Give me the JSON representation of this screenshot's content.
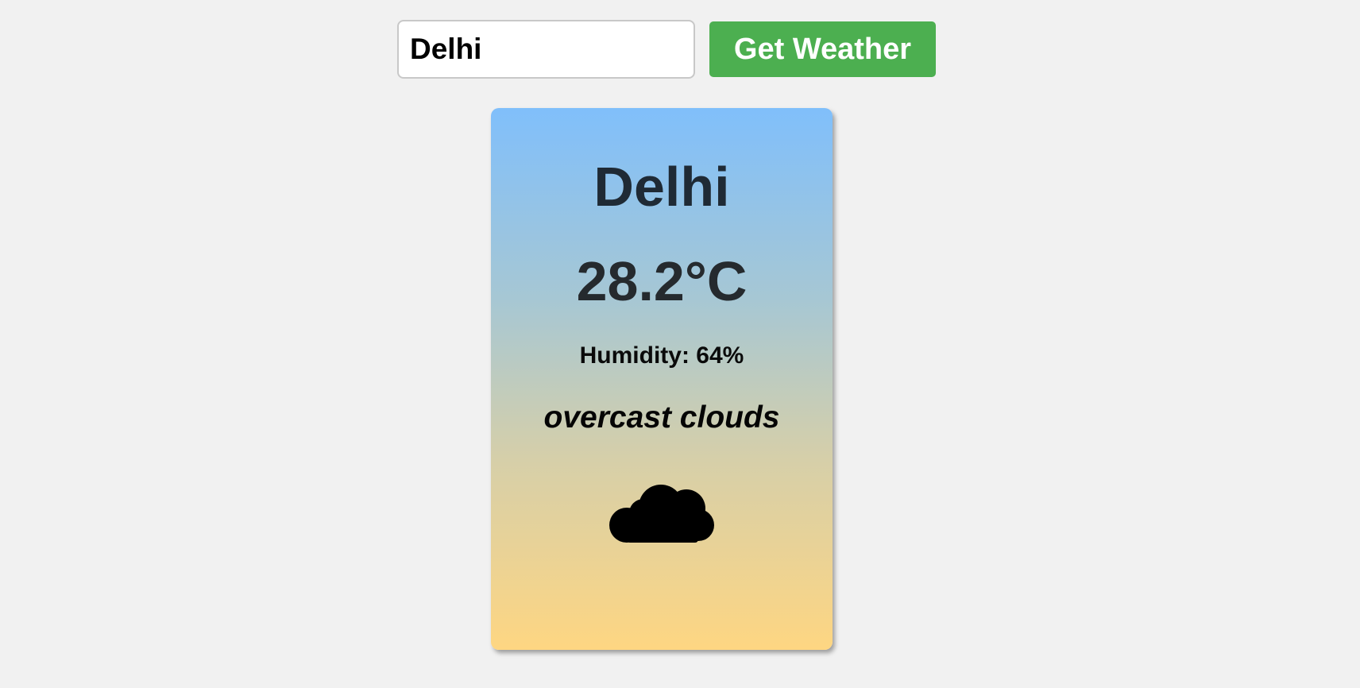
{
  "search": {
    "value": "Delhi",
    "button_label": "Get Weather"
  },
  "weather": {
    "city": "Delhi",
    "temperature": "28.2°C",
    "humidity": "Humidity: 64%",
    "description": "overcast clouds",
    "icon": "cloud-icon"
  },
  "colors": {
    "background": "#f1f1f1",
    "button": "#4caf50",
    "card_gradient_top": "#80bffb",
    "card_gradient_bottom": "#fed682"
  }
}
